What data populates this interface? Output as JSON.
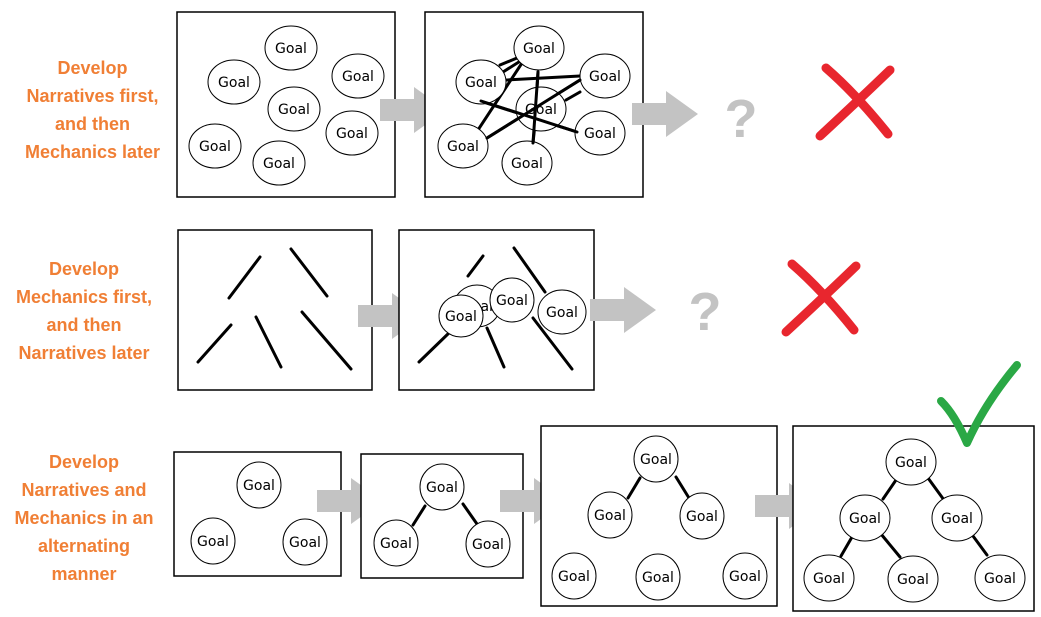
{
  "colors": {
    "label": "#f07f35",
    "arrow": "#c3c3c3",
    "question": "#c3c3c3",
    "cross": "#e8262e",
    "check": "#2aa845",
    "line": "#000000"
  },
  "node_text": "Goal",
  "question_mark": "?",
  "rows": [
    {
      "label_lines": [
        "Develop",
        "Narratives first,",
        "and then",
        "Mechanics later"
      ],
      "outcome": "fail"
    },
    {
      "label_lines": [
        "Develop",
        "Mechanics first,",
        "and then",
        "Narratives later"
      ],
      "outcome": "fail"
    },
    {
      "label_lines": [
        "Develop",
        "Narratives and",
        "Mechanics in an",
        "alternating",
        "manner"
      ],
      "outcome": "success"
    }
  ]
}
